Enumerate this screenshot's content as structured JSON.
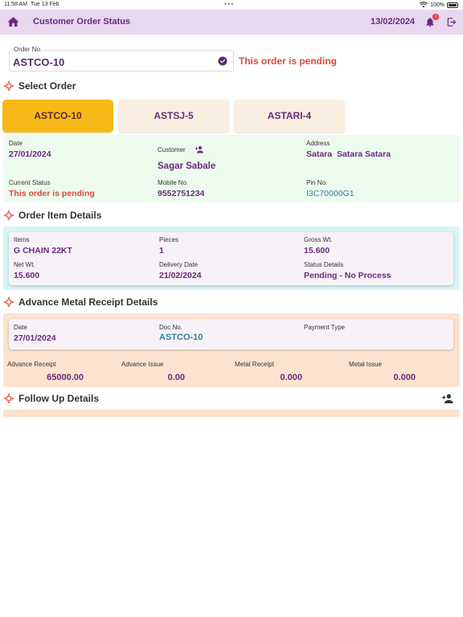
{
  "statusbar": {
    "time": "11:58 AM",
    "date": "Tue 13 Feb",
    "battery": "100%"
  },
  "appbar": {
    "title": "Customer Order Status",
    "date": "13/02/2024",
    "notification_count": "1"
  },
  "order": {
    "label": "Order No.",
    "value": "ASTCO-10",
    "status_text": "This order is pending"
  },
  "select_order": {
    "heading": "Select Order",
    "tabs": [
      {
        "label": "ASTCO-10",
        "active": true
      },
      {
        "label": "ASTSJ-5",
        "active": false
      },
      {
        "label": "ASTARI-4",
        "active": false
      }
    ]
  },
  "summary": {
    "date_label": "Date",
    "date": "27/01/2024",
    "customer_label": "Customer",
    "customer": "Sagar Sabale",
    "address_label": "Address",
    "address": "Satara  Satara Satara",
    "status_label": "Current Status",
    "status": "This order is pending",
    "mobile_label": "Mobile No.",
    "mobile": "9552751234",
    "pin_label": "Pin No.",
    "pin": "I3C70000G1"
  },
  "order_items": {
    "heading": "Order Item Details",
    "items_label": "Items",
    "item": "G CHAIN 22KT",
    "pieces_label": "Pieces",
    "pieces": "1",
    "gross_label": "Gross Wt.",
    "gross": "15.600",
    "net_label": "Net Wt.",
    "net": "15.600",
    "delivery_label": "Delivery Date",
    "delivery": "21/02/2024",
    "status_label": "Status Details",
    "status": "Pending - No Process"
  },
  "advance": {
    "heading": "Advance Metal Receipt Details",
    "date_label": "Date",
    "date": "27/01/2024",
    "doc_label": "Doc No.",
    "doc": "ASTCO-10",
    "payment_label": "Payment Type",
    "adv_receipt_label": "Advance Receipt",
    "adv_receipt": "65000.00",
    "adv_issue_label": "Advance Issue",
    "adv_issue": "0.00",
    "metal_receipt_label": "Metal Receipt",
    "metal_receipt": "0.000",
    "metal_issue_label": "Metal Issue",
    "metal_issue": "0.000"
  },
  "followup": {
    "heading": "Follow Up Details"
  },
  "colors": {
    "accent": "#6a2a7e",
    "pending": "#e0473b",
    "active_tab": "#f7b918",
    "appbar": "#e8d7ef"
  },
  "icons": [
    "home-icon",
    "bell-icon",
    "logout-icon",
    "check-circle-icon",
    "section-icon",
    "person-add-icon",
    "wifi-icon",
    "battery-icon"
  ]
}
